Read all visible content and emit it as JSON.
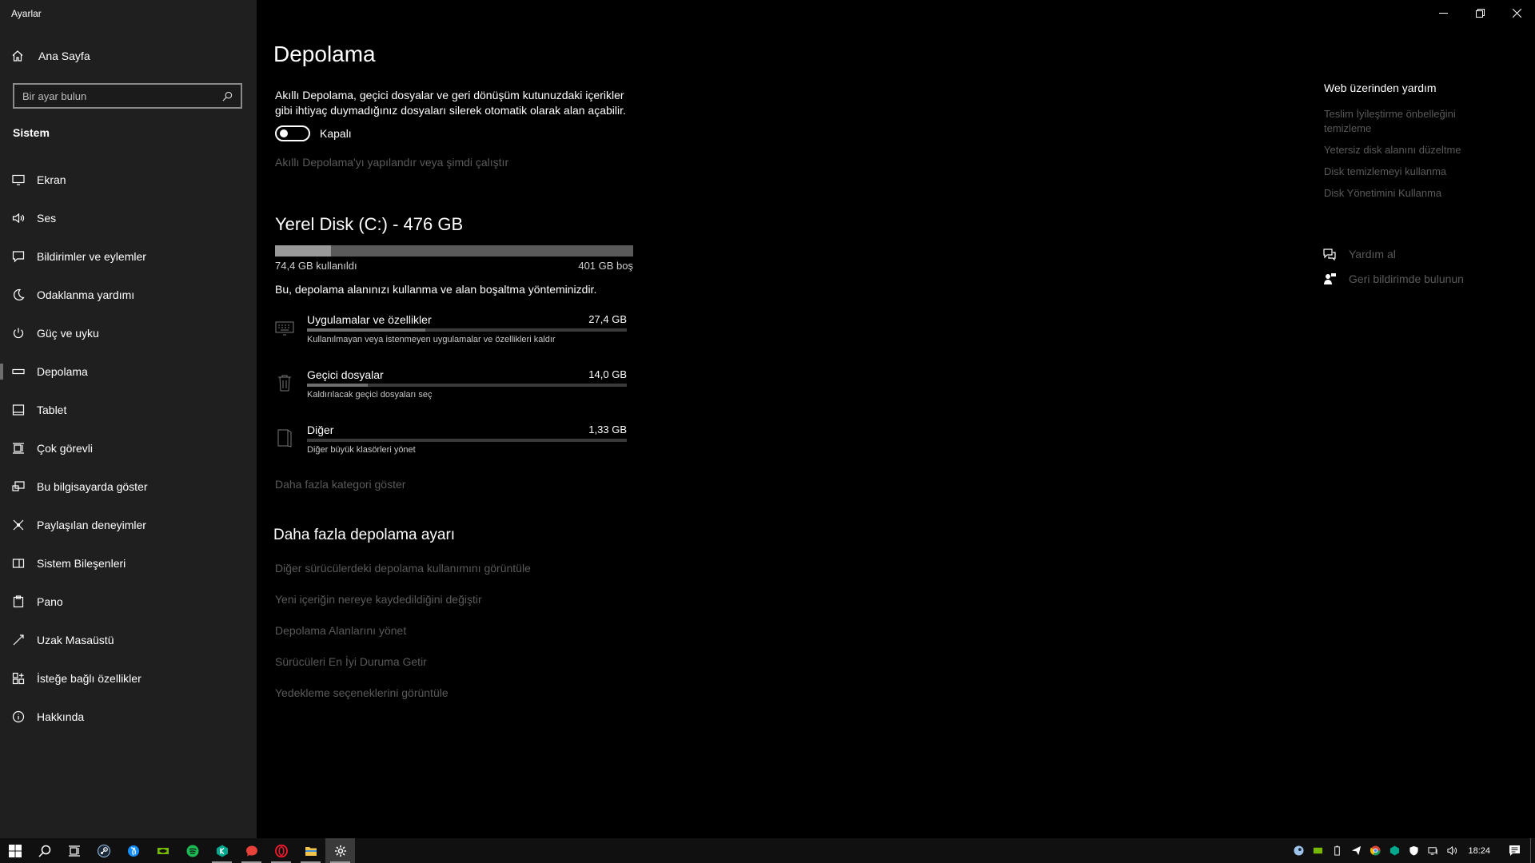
{
  "app": {
    "title": "Ayarlar"
  },
  "sidebar": {
    "home_label": "Ana Sayfa",
    "search_placeholder": "Bir ayar bulun",
    "section": "Sistem",
    "items": [
      {
        "label": "Ekran",
        "icon": "monitor-icon"
      },
      {
        "label": "Ses",
        "icon": "speaker-icon"
      },
      {
        "label": "Bildirimler ve eylemler",
        "icon": "notification-icon"
      },
      {
        "label": "Odaklanma yardımı",
        "icon": "moon-icon"
      },
      {
        "label": "Güç ve uyku",
        "icon": "power-icon"
      },
      {
        "label": "Depolama",
        "icon": "storage-icon",
        "active": true
      },
      {
        "label": "Tablet",
        "icon": "tablet-icon"
      },
      {
        "label": "Çok görevli",
        "icon": "multitasking-icon"
      },
      {
        "label": "Bu bilgisayarda göster",
        "icon": "project-icon"
      },
      {
        "label": "Paylaşılan deneyimler",
        "icon": "shared-icon"
      },
      {
        "label": "Sistem Bileşenleri",
        "icon": "components-icon"
      },
      {
        "label": "Pano",
        "icon": "clipboard-icon"
      },
      {
        "label": "Uzak Masaüstü",
        "icon": "remote-icon"
      },
      {
        "label": "İsteğe bağlı özellikler",
        "icon": "optional-features-icon"
      },
      {
        "label": "Hakkında",
        "icon": "info-icon"
      }
    ]
  },
  "main": {
    "title": "Depolama",
    "smart_storage": {
      "description": "Akıllı Depolama, geçici dosyalar ve geri dönüşüm kutunuzdaki içerikler gibi ihtiyaç duymadığınız dosyaları silerek otomatik olarak alan açabilir.",
      "toggle_state": "Kapalı",
      "config_link": "Akıllı Depolama'yı yapılandır veya şimdi çalıştır"
    },
    "disk": {
      "title": "Yerel Disk (C:) - 476 GB",
      "used_label": "74,4 GB kullanıldı",
      "free_label": "401 GB boş",
      "used_fraction": 0.156,
      "info": "Bu, depolama alanınızı kullanma ve alan boşaltma yönteminizdir."
    },
    "categories": [
      {
        "name": "Uygulamalar ve özellikler",
        "size": "27,4 GB",
        "sub": "Kullanılmayan veya istenmeyen uygulamalar ve özellikleri kaldır",
        "fraction": 0.37,
        "icon": "apps-keyboard-icon"
      },
      {
        "name": "Geçici dosyalar",
        "size": "14,0 GB",
        "sub": "Kaldırılacak geçici dosyaları seç",
        "fraction": 0.19,
        "icon": "trash-icon"
      },
      {
        "name": "Diğer",
        "size": "1,33 GB",
        "sub": "Diğer büyük klasörleri yönet",
        "fraction": 0.0,
        "icon": "folder-other-icon"
      }
    ],
    "show_more_categories": "Daha fazla kategori göster",
    "more_settings": {
      "title": "Daha fazla depolama ayarı",
      "links": [
        "Diğer sürücülerdeki depolama kullanımını görüntüle",
        "Yeni içeriğin nereye kaydedildiğini değiştir",
        "Depolama Alanlarını yönet",
        "Sürücüleri En İyi Duruma Getir",
        "Yedekleme seçeneklerini görüntüle"
      ]
    }
  },
  "help": {
    "title": "Web üzerinden yardım",
    "links": [
      "Teslim İyileştirme önbelleğini temizleme",
      "Yetersiz disk alanını düzeltme",
      "Disk temizlemeyi kullanma",
      "Disk Yönetimini Kullanma"
    ],
    "get_help": "Yardım al",
    "feedback": "Geri bildirimde bulunun"
  },
  "taskbar": {
    "clock": "18:24",
    "colors": {
      "spotify": "#1db954",
      "kaspersky": "#00a88e",
      "opera": "#ff1b2d",
      "nvidia": "#76b900"
    }
  }
}
